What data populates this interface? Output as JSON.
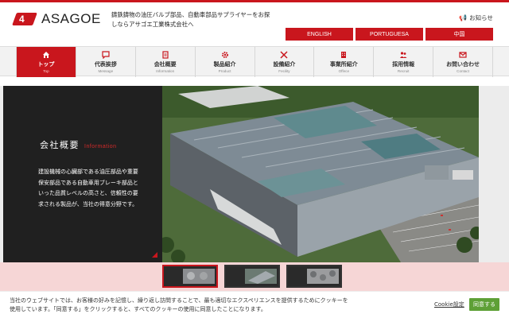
{
  "header": {
    "logo_glyph": "4",
    "logo_text": "ASAGOE",
    "tagline": "鋳鉄鋳物の油圧バルブ部品、自動車部品サプライヤーをお探しならアサゴエ工業株式会社へ",
    "contact_label": "お知らせ",
    "languages": [
      "ENGLISH",
      "PORTUGUESA",
      "中国"
    ]
  },
  "nav": {
    "items": [
      {
        "ja": "トップ",
        "en": "Top",
        "icon": "home-icon",
        "active": true
      },
      {
        "ja": "代表挨拶",
        "en": "Message",
        "icon": "speech-bubble-icon",
        "active": false
      },
      {
        "ja": "会社概要",
        "en": "Information",
        "icon": "document-icon",
        "active": false
      },
      {
        "ja": "製品紹介",
        "en": "Product",
        "icon": "gear-icon",
        "active": false
      },
      {
        "ja": "設備紹介",
        "en": "Fecility",
        "icon": "tools-icon",
        "active": false
      },
      {
        "ja": "事業所紹介",
        "en": "Offece",
        "icon": "building-icon",
        "active": false
      },
      {
        "ja": "採用情報",
        "en": "Recruit",
        "icon": "people-icon",
        "active": false
      },
      {
        "ja": "お問い合わせ",
        "en": "Contact",
        "icon": "mail-icon",
        "active": false
      }
    ]
  },
  "hero": {
    "title_ja": "会社概要",
    "title_en": "Information",
    "body": "建設機械の心臓部である油圧部品や重要保安部品である自動車用ブレーキ部品といった品質レベルの高さと、信頼性の要求される製品が、当社の得意分野です。"
  },
  "thumbnails": {
    "active_index": 0
  },
  "cookie": {
    "text": "当社のウェブサイトでは、お客様の好みを記憶し、繰り返し訪問することで、最も適切なエクスペリエンスを提供するためにクッキーを使用しています。「同意する」をクリックすると、すべてのクッキーの使用に同意したことになります。",
    "settings_label": "Cookie設定",
    "accept_label": "同意する",
    "accept_color": "#5ea036"
  },
  "colors": {
    "brand": "#c9161d",
    "hero_panel": "#202020"
  }
}
